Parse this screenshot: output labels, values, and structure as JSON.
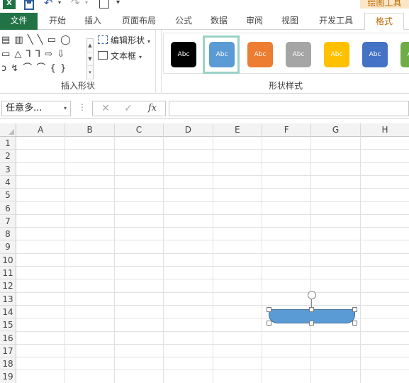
{
  "quick_access": {
    "excel_logo": "X",
    "undo_glyph": "↶",
    "redo_glyph": "↷",
    "dropdown_glyph": "▾",
    "more_glyph": "▾"
  },
  "contextual_title": "绘图工具",
  "tabs": {
    "file": "文件",
    "home": "开始",
    "insert": "插入",
    "page_layout": "页面布局",
    "formulas": "公式",
    "data": "数据",
    "review": "审阅",
    "view": "视图",
    "developer": "开发工具",
    "format": "格式"
  },
  "ribbon": {
    "insert_shapes": {
      "label": "插入形状",
      "shape_rows": [
        "▤ ▥ ╲ ╲ ▭ ◯",
        "▭ △ ⅂ ⅂ ⇨ ⇩",
        "ↄ ↯ ⌒ ⌒ { }"
      ],
      "edit_shape": "编辑形状",
      "text_box": "文本框"
    },
    "shape_styles": {
      "label": "形状样式",
      "swatches": [
        {
          "text": "Abc",
          "color": "#000000"
        },
        {
          "text": "Abc",
          "color": "#5b9bd5"
        },
        {
          "text": "Abc",
          "color": "#ed7d31"
        },
        {
          "text": "Abc",
          "color": "#a5a5a5"
        },
        {
          "text": "Abc",
          "color": "#ffc000"
        },
        {
          "text": "Abc",
          "color": "#4472c4"
        },
        {
          "text": "Abc",
          "color": "#70ad47"
        }
      ],
      "selected_index": 1
    }
  },
  "formula_bar": {
    "name_box": "任意多...",
    "cancel_glyph": "✕",
    "enter_glyph": "✓",
    "fx": "fx",
    "value": ""
  },
  "grid": {
    "columns": [
      "A",
      "B",
      "C",
      "D",
      "E",
      "F",
      "G",
      "H"
    ],
    "rows": [
      "1",
      "2",
      "3",
      "4",
      "5",
      "6",
      "7",
      "8",
      "9",
      "10",
      "11",
      "12",
      "13",
      "14",
      "15",
      "16",
      "17",
      "18",
      "19"
    ]
  },
  "colors": {
    "file_tab": "#217346",
    "contextual_accent": "#bb6a00",
    "shape_fill": "#5b9bd5"
  }
}
